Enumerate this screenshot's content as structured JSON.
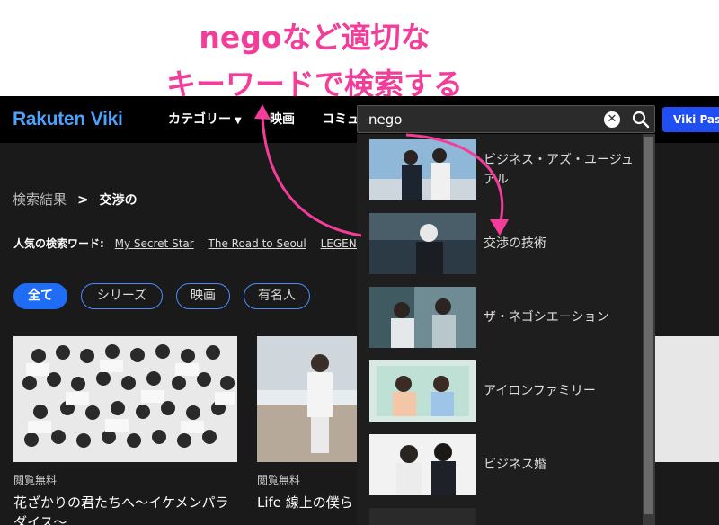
{
  "annotation": {
    "line1": "negoなど適切な",
    "line2": "キーワードで検索する",
    "color": "#f23d9a"
  },
  "header": {
    "logo_rakuten": "Rakuten",
    "logo_viki": "Viki",
    "nav": {
      "category": "カテゴリー",
      "movie": "映画",
      "community": "コミュ"
    },
    "search": {
      "value": "nego"
    },
    "vikipass_label": "Viki Pas"
  },
  "breadcrumb": {
    "root": "検索結果",
    "sep": ">",
    "term": "交渉の"
  },
  "popular": {
    "label": "人気の検索ワード:",
    "words": [
      "My Secret Star",
      "The Road to Seoul",
      "LEGEND"
    ]
  },
  "filters": {
    "all": "全て",
    "series": "シリーズ",
    "movie": "映画",
    "celebrity": "有名人"
  },
  "cards": [
    {
      "badge": "閲覧無料",
      "title": "花ざかりの君たちへ～イケメンパラダイス～"
    },
    {
      "badge": "閲覧無料",
      "title": "Life 線上の僕ら"
    }
  ],
  "dropdown": {
    "items": [
      {
        "title": "ビジネス・アズ・ユージュアル"
      },
      {
        "title": "交渉の技術"
      },
      {
        "title": "ザ・ネゴシエーション"
      },
      {
        "title": "アイロンファミリー"
      },
      {
        "title": "ビジネス婚"
      }
    ]
  },
  "colors": {
    "accent": "#1f6cf5",
    "logo": "#4aa3ff",
    "annotation": "#f23d9a"
  }
}
